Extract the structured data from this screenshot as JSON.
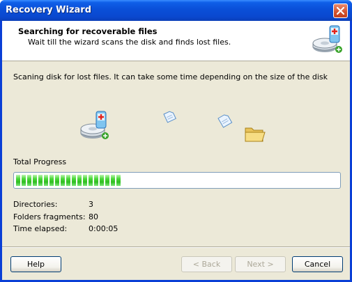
{
  "window": {
    "title": "Recovery Wizard"
  },
  "header": {
    "title": "Searching for recoverable files",
    "subtitle": "Wait till the wizard scans the disk and finds lost files."
  },
  "description": "Scaning disk for lost files. It can take some time depending on the size of the disk",
  "progress": {
    "label": "Total Progress",
    "fraction": 0.33
  },
  "stats": [
    {
      "label": "Directories:",
      "value": "3"
    },
    {
      "label": "Folders fragments:",
      "value": "80"
    },
    {
      "label": "Time elapsed:",
      "value": "0:00:05"
    }
  ],
  "buttons": {
    "help": "Help",
    "back": "< Back",
    "next": "Next >",
    "cancel": "Cancel"
  },
  "colors": {
    "titlebar": "#0a4fd8",
    "progress_fill": "#2ebd20",
    "window_bg": "#ece9d8"
  }
}
